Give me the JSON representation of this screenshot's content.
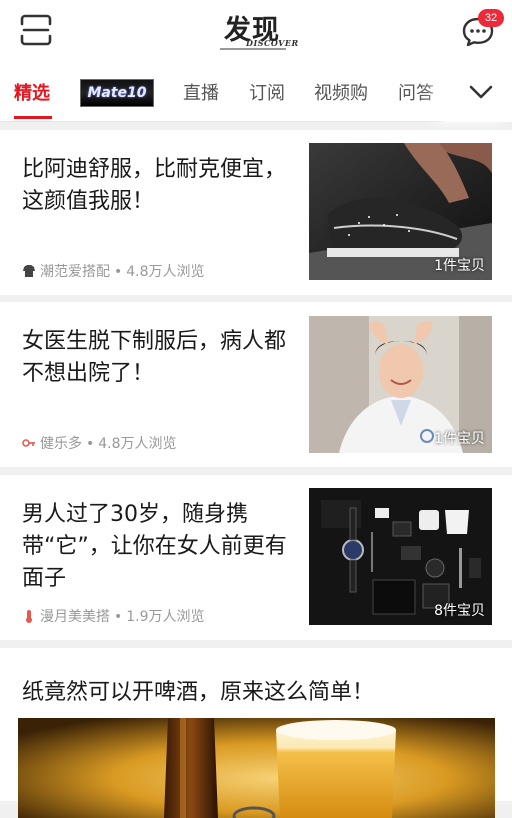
{
  "header": {
    "logo_main": "发现",
    "logo_sub": "DISCOVER",
    "message_badge": "32"
  },
  "tabs": [
    {
      "label": "精选",
      "active": true
    },
    {
      "label": "Mate10",
      "kind": "promo-logo"
    },
    {
      "label": "直播"
    },
    {
      "label": "订阅"
    },
    {
      "label": "视频购"
    },
    {
      "label": "问答"
    }
  ],
  "feed": [
    {
      "title": "比阿迪舒服，比耐克便宜，这颜值我服！",
      "source": "潮范爱搭配",
      "views": "4.8万人浏览",
      "item_count": "1件宝贝",
      "icon": "shirt-icon",
      "image": "sneaker-photo"
    },
    {
      "title": "女医生脱下制服后，病人都不想出院了！",
      "source": "健乐多",
      "views": "4.8万人浏览",
      "item_count": "1件宝贝",
      "icon": "key-icon",
      "image": "doctor-photo"
    },
    {
      "title": "男人过了30岁，随身携带“它”，让你在女人前更有面子",
      "source": "漫月美美搭",
      "views": "1.9万人浏览",
      "item_count": "8件宝贝",
      "icon": "thermometer-icon",
      "image": "accessories-photo"
    },
    {
      "title": "纸竟然可以开啤酒，原来这么简单！",
      "image": "beer-photo"
    }
  ],
  "colors": {
    "accent": "#e4161f",
    "badge": "#ec2a3a",
    "meta_text": "#999999"
  }
}
